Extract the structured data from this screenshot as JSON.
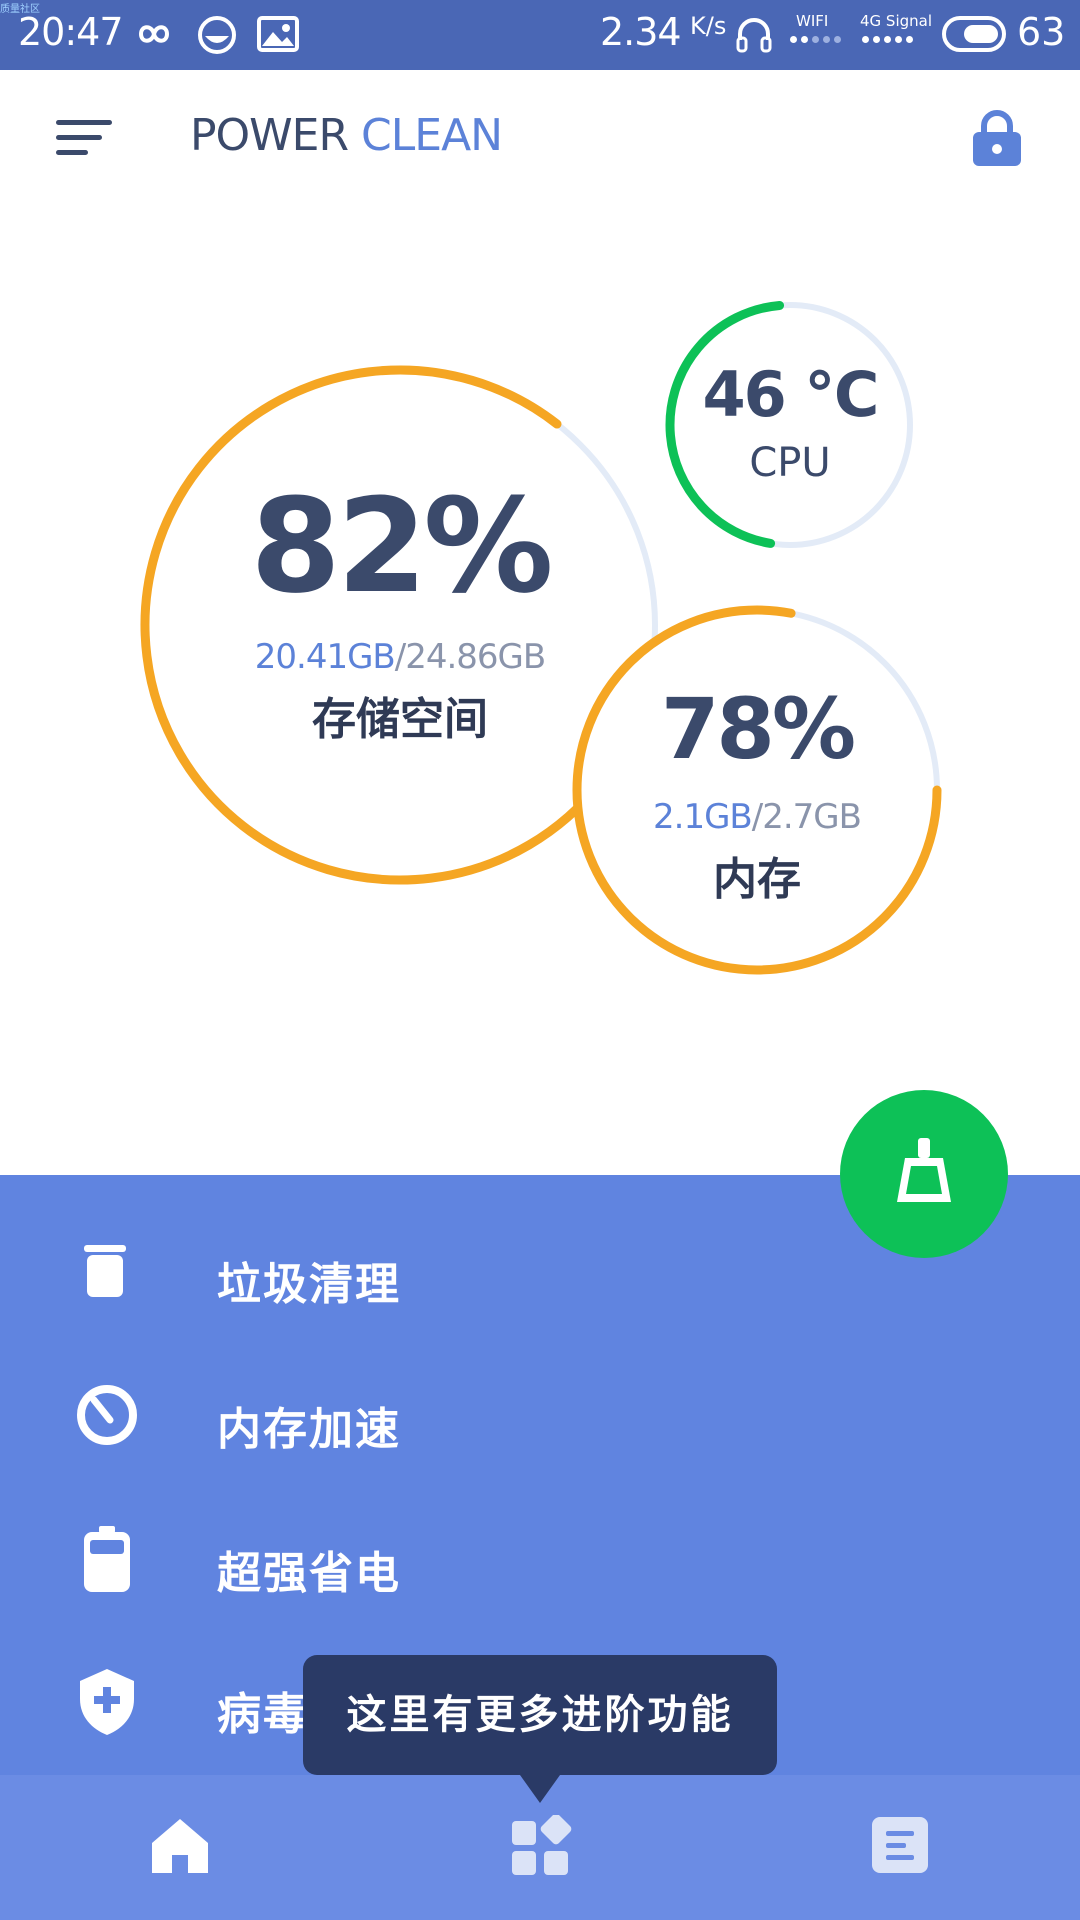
{
  "status_bar": {
    "watermark": "质量社区",
    "time": "20:47",
    "speed_value": "2.34",
    "speed_unit": "K/s",
    "wifi_label": "WIFI",
    "signal_label": "4G Signal",
    "battery_level": "63",
    "icons": [
      "infinity-icon",
      "face-icon",
      "image-icon",
      "headphones-icon",
      "toggle-icon"
    ]
  },
  "header": {
    "title_part1": "POWER",
    "title_part2": "CLEAN",
    "menu_icon": "menu-icon",
    "lock_icon": "lock-icon"
  },
  "storage": {
    "percent": "82%",
    "used": "20.41GB",
    "total": "/24.86GB",
    "label": "存储空间",
    "fraction": 0.82,
    "color": "#f5a623"
  },
  "cpu": {
    "temp": "46 ℃",
    "label": "CPU",
    "fraction": 0.46,
    "color": "#0dc157"
  },
  "memory": {
    "percent": "78%",
    "used": "2.1GB",
    "total": "/2.7GB",
    "label": "内存",
    "fraction": 0.78,
    "color": "#f5a623"
  },
  "track_color": "#e3ebf7",
  "fab": {
    "icon": "broom-icon"
  },
  "features": [
    {
      "label": "垃圾清理",
      "icon": "trash-icon"
    },
    {
      "label": "内存加速",
      "icon": "speedometer-icon"
    },
    {
      "label": "超强省电",
      "icon": "battery-icon"
    },
    {
      "label": "病毒",
      "icon": "shield-plus-icon"
    }
  ],
  "tooltip": {
    "text": "这里有更多进阶功能"
  },
  "bottom_nav": [
    {
      "icon": "home-icon"
    },
    {
      "icon": "apps-icon"
    },
    {
      "icon": "document-icon"
    }
  ],
  "colors": {
    "status_bar": "#4a67b5",
    "panel": "#6084e0",
    "nav": "#6b8ce4",
    "accent_blue": "#5c82d8",
    "text_dark": "#3b4a6b"
  }
}
